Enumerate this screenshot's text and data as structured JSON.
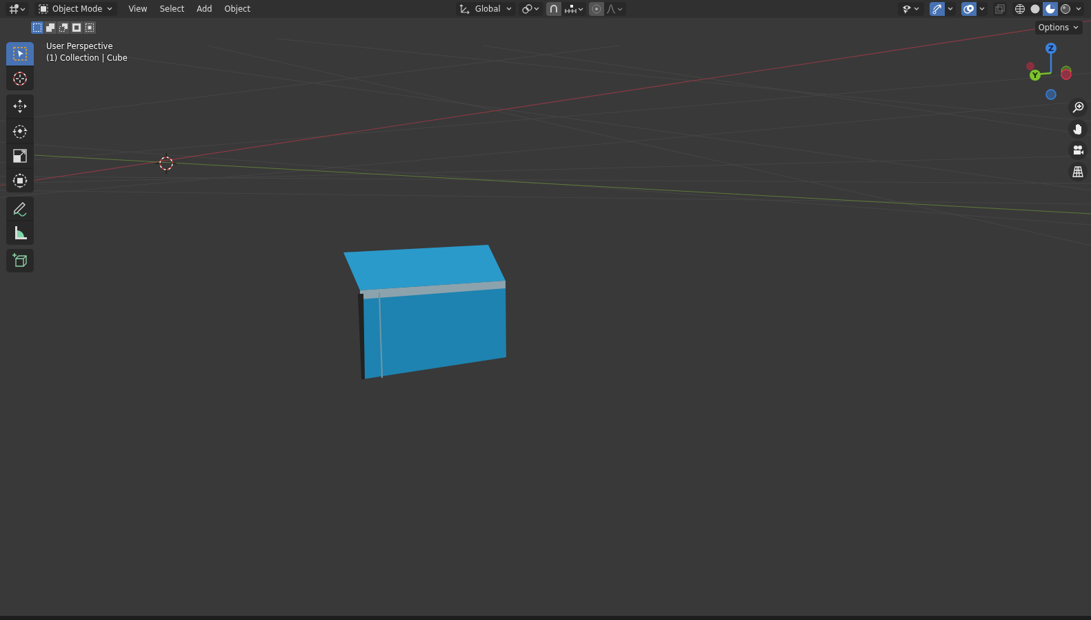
{
  "header": {
    "mode": "Object Mode",
    "menus": [
      "View",
      "Select",
      "Add",
      "Object"
    ],
    "orientation": "Global",
    "snap_on": true,
    "proportional_on": true,
    "gizmos_on": true,
    "overlays_on": true,
    "xray_on": false,
    "shading_modes": [
      {
        "kind": "wireframe",
        "selected": false
      },
      {
        "kind": "solid",
        "selected": false
      },
      {
        "kind": "material",
        "selected": true
      },
      {
        "kind": "rendered",
        "selected": false
      }
    ]
  },
  "select_modes": [
    {
      "kind": "new",
      "selected": true
    },
    {
      "kind": "extend",
      "selected": false
    },
    {
      "kind": "subtract",
      "selected": false
    },
    {
      "kind": "invert",
      "selected": false
    },
    {
      "kind": "intersect",
      "selected": false
    }
  ],
  "options": "Options",
  "viewport": {
    "perspective": "User Perspective",
    "collection": "(1) Collection | Cube"
  },
  "tool_groups": [
    {
      "tools": [
        {
          "kind": "select",
          "selected": true
        },
        {
          "kind": "cursor",
          "selected": false
        }
      ]
    },
    {
      "tools": [
        {
          "kind": "move",
          "selected": false
        },
        {
          "kind": "rotate",
          "selected": false
        },
        {
          "kind": "scale",
          "selected": false
        },
        {
          "kind": "transform",
          "selected": false
        }
      ]
    },
    {
      "tools": [
        {
          "kind": "annotate",
          "selected": false
        },
        {
          "kind": "measure",
          "selected": false
        }
      ]
    },
    {
      "tools": [
        {
          "kind": "add_cube",
          "selected": false
        }
      ]
    }
  ],
  "gizmo": {
    "z_label": "Z",
    "y_label": "Y"
  }
}
